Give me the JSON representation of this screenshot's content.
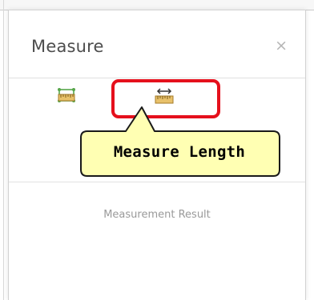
{
  "panel": {
    "title": "Measure",
    "close_label": "×"
  },
  "tools": [
    {
      "name": "measure-area",
      "icon": "measure-area-icon",
      "selected": false
    },
    {
      "name": "measure-length",
      "icon": "measure-length-icon",
      "selected": true
    }
  ],
  "callout": {
    "text": "Measure Length"
  },
  "result": {
    "label": "Measurement Result"
  },
  "colors": {
    "highlight": "#e5101c",
    "callout_fill": "#ffffb3",
    "icon_green": "#57a64a",
    "icon_tan": "#c9a04a"
  }
}
